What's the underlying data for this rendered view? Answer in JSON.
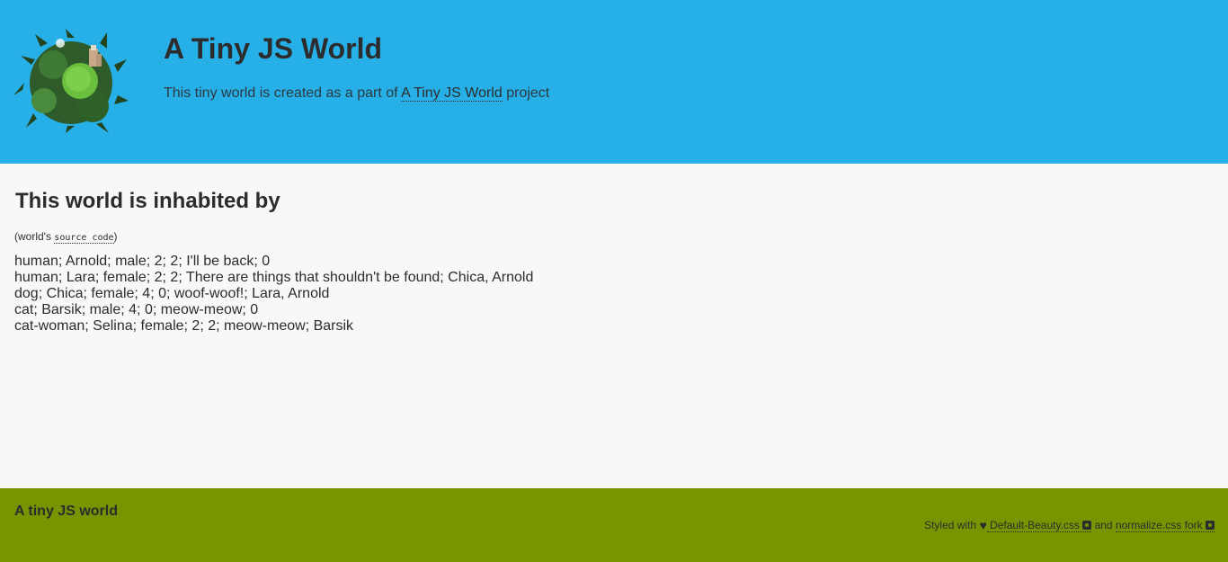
{
  "header": {
    "title": "A Tiny JS World",
    "description_prefix": "This tiny world is created as a part of ",
    "project_link": "A Tiny JS World",
    "description_suffix": " project",
    "logo_icon": "tiny-planet-logo",
    "bg_color": "#27b0e8"
  },
  "main": {
    "heading": "This world is inhabited by",
    "source_prefix": "(world's ",
    "source_link": "source code",
    "source_suffix": ")",
    "inhabitants": [
      "human; Arnold; male; 2; 2; I'll be back; 0",
      "human; Lara; female; 2; 2; There are things that shouldn't be found; Chica, Arnold",
      "dog; Chica; female; 4; 0; woof-woof!; Lara, Arnold",
      "cat; Barsik; male; 4; 0; meow-meow; 0",
      "cat-woman; Selina; female; 2; 2; meow-meow; Barsik"
    ]
  },
  "footer": {
    "title": "A tiny JS world",
    "styled_with": "Styled with ",
    "default_beauty_link": " Default-Beauty.css ",
    "and": " and ",
    "normalize_link": "normalize.css fork",
    "heart_icon": "heart-icon",
    "github_icon": "github-icon",
    "bg_color": "#779500"
  }
}
